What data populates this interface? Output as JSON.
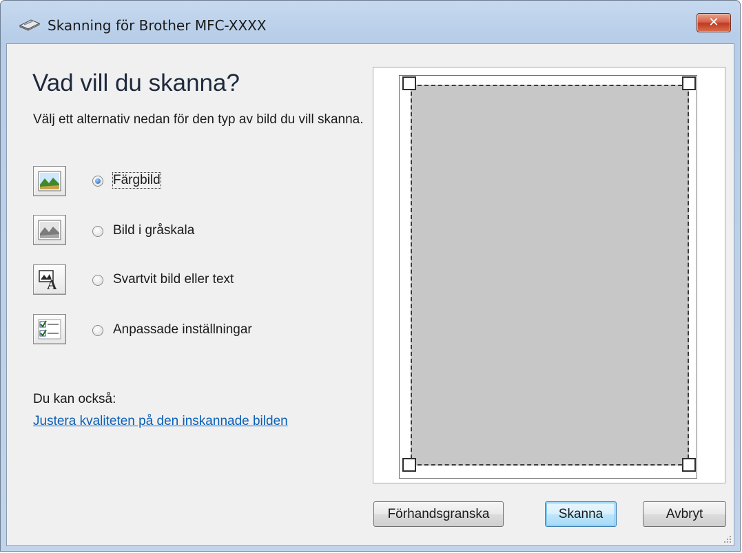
{
  "window": {
    "title": "Skanning för Brother MFC-XXXX",
    "close_label": "✕"
  },
  "main": {
    "heading": "Vad vill du skanna?",
    "description": "Välj ett alternativ nedan för den typ av bild du vill skanna.",
    "options": [
      {
        "label": "Färgbild",
        "selected": true,
        "icon": "color-picture-icon"
      },
      {
        "label": "Bild i gråskala",
        "selected": false,
        "icon": "grayscale-picture-icon"
      },
      {
        "label": "Svartvit bild eller text",
        "selected": false,
        "icon": "black-white-text-icon"
      },
      {
        "label": "Anpassade inställningar",
        "selected": false,
        "icon": "custom-settings-icon"
      }
    ],
    "also_label": "Du kan också:",
    "adjust_link": "Justera kvaliteten på den inskannade bilden"
  },
  "buttons": {
    "preview": "Förhandsgranska",
    "scan": "Skanna",
    "cancel": "Avbryt"
  },
  "colors": {
    "accent_link": "#0a5fb4",
    "close_button": "#c23a22",
    "scan_area": "#c7c7c7"
  }
}
